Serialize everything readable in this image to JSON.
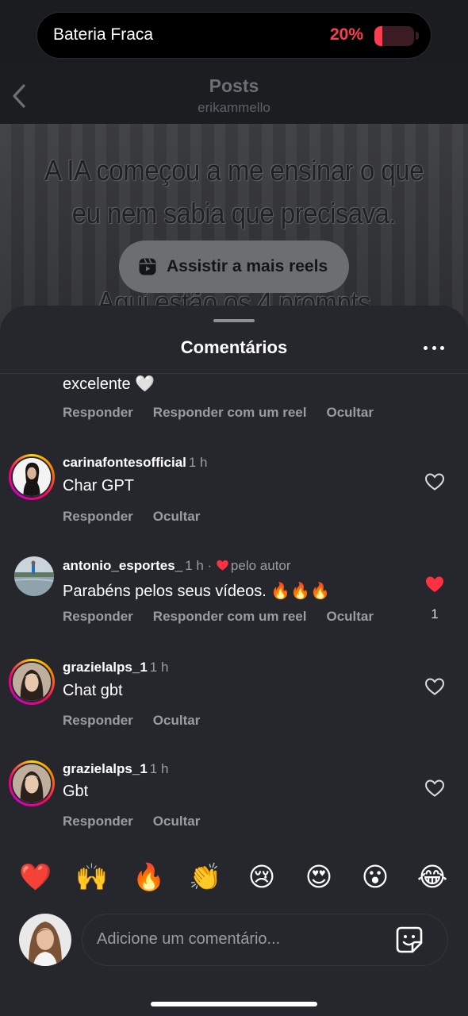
{
  "status": {
    "banner_text": "Bateria Fraca",
    "battery_percent_text": "20%",
    "battery_level": 0.2
  },
  "post": {
    "title": "Posts",
    "username": "erikammello",
    "overlay_line1": "A IA começou a me ensinar o que",
    "overlay_line2": "eu nem sabia que precisava.",
    "overlay_line3": "Aqui estão os 4 prompts",
    "reels_button": "Assistir a mais reels"
  },
  "sheet": {
    "title": "Comentários"
  },
  "comments": [
    {
      "partial": true,
      "text": "excelente 🤍",
      "actions": [
        "Responder",
        "Responder com um reel",
        "Ocultar"
      ]
    },
    {
      "username": "carinafontesofficial",
      "time": "1 h",
      "text": "Char GPT",
      "actions": [
        "Responder",
        "Ocultar"
      ],
      "liked": false
    },
    {
      "username": "antonio_esportes_",
      "time": "1 h ·",
      "author_note": "pelo autor",
      "text": "Parabéns pelos seus vídeos. 🔥🔥🔥",
      "actions": [
        "Responder",
        "Responder com um reel",
        "Ocultar"
      ],
      "liked": true,
      "like_count": "1"
    },
    {
      "username": "grazielalps_1",
      "time": "1 h",
      "text": "Chat gbt",
      "actions": [
        "Responder",
        "Ocultar"
      ],
      "liked": false
    },
    {
      "username": "grazielalps_1",
      "time": "1 h",
      "text": "Gbt",
      "actions": [
        "Responder",
        "Ocultar"
      ],
      "liked": false
    }
  ],
  "quick_reactions": [
    "❤️",
    "🙌",
    "🔥",
    "👏",
    "😢",
    "😍",
    "😮",
    "😂"
  ],
  "composer": {
    "placeholder": "Adicione um comentário..."
  },
  "colors": {
    "sheet_bg": "#25272c",
    "secondary_text": "#9a9ca2",
    "like_red": "#ff3040",
    "battery_red": "#ff3b50"
  }
}
